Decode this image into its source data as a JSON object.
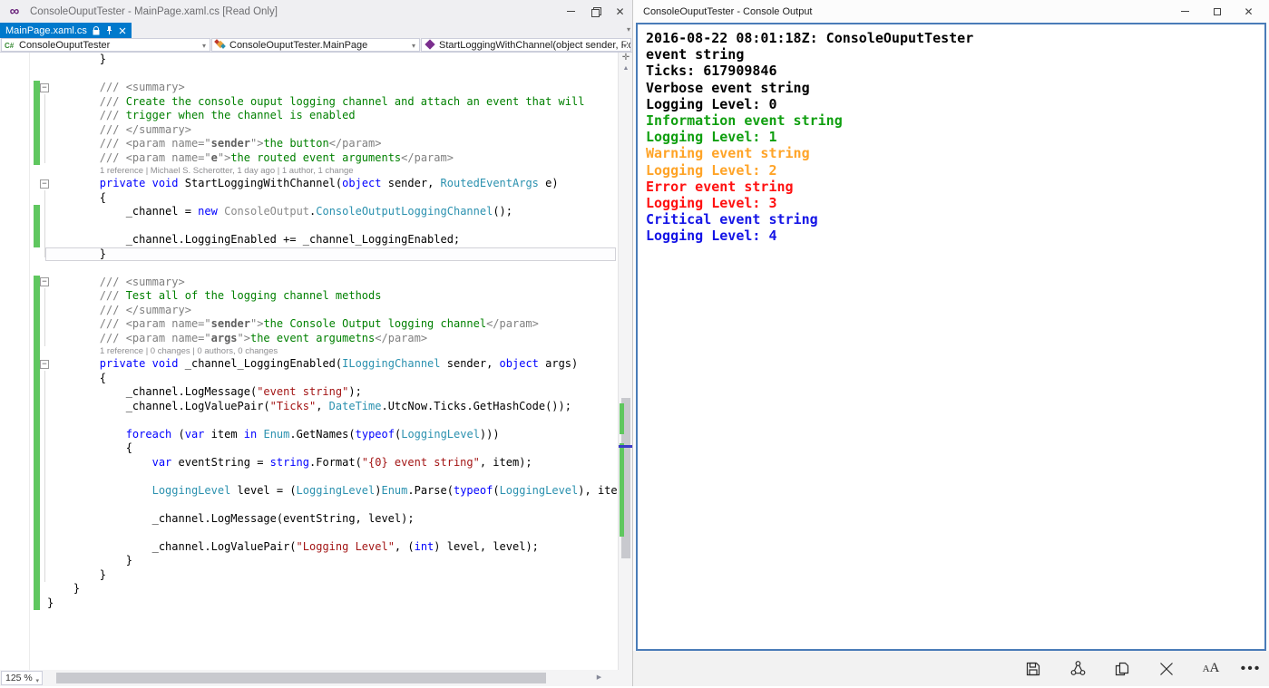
{
  "vs_window": {
    "title": "ConsoleOuputTester - MainPage.xaml.cs [Read Only]",
    "tab_label": "MainPage.xaml.cs",
    "tab_icons": [
      "lock-icon",
      "pin-icon",
      "close-icon"
    ],
    "nav_project": "ConsoleOuputTester",
    "nav_class": "ConsoleOuputTester.MainPage",
    "nav_method": "StartLoggingWithChannel(object sender, RoutedEver",
    "zoom_level": "125 %",
    "syntax_palette": {
      "plain": "#000000",
      "keyword": "#0000FF",
      "type": "#2B91AF",
      "string": "#A31515",
      "comment": "#008000",
      "doc_tag": "#808080",
      "faded_namespace": "#8A8A8A",
      "change_bar": "#5FC75F",
      "active_tab": "#0079CC"
    },
    "code_lines": [
      {
        "type": "code",
        "seg": [
          [
            "p",
            "        }"
          ]
        ]
      },
      {
        "type": "blank"
      },
      {
        "type": "code",
        "bar": true,
        "fold": true,
        "seg": [
          [
            "g",
            "        /// <summary>"
          ]
        ]
      },
      {
        "type": "code",
        "bar": true,
        "seg": [
          [
            "g",
            "        /// "
          ],
          [
            "c",
            "Create the console ouput logging channel and attach an event that will"
          ]
        ]
      },
      {
        "type": "code",
        "bar": true,
        "seg": [
          [
            "g",
            "        /// "
          ],
          [
            "c",
            "trigger when the channel is enabled"
          ]
        ]
      },
      {
        "type": "code",
        "bar": true,
        "seg": [
          [
            "g",
            "        /// </summary>"
          ]
        ]
      },
      {
        "type": "code",
        "bar": true,
        "seg": [
          [
            "g",
            "        /// <param name=\""
          ],
          [
            "a",
            "sender"
          ],
          [
            "g",
            "\">"
          ],
          [
            "c",
            "the button"
          ],
          [
            "g",
            "</param>"
          ]
        ]
      },
      {
        "type": "code",
        "bar": true,
        "seg": [
          [
            "g",
            "        /// <param name=\""
          ],
          [
            "a",
            "e"
          ],
          [
            "g",
            "\">"
          ],
          [
            "c",
            "the routed event arguments"
          ],
          [
            "g",
            "</param>"
          ]
        ]
      },
      {
        "type": "lens",
        "text": "1 reference | Michael S. Scherotter, 1 day ago | 1 author, 1 change"
      },
      {
        "type": "code",
        "fold": true,
        "seg": [
          [
            "k",
            "        private"
          ],
          [
            "p",
            " "
          ],
          [
            "k",
            "void"
          ],
          [
            "p",
            " StartLoggingWithChannel("
          ],
          [
            "k",
            "object"
          ],
          [
            "p",
            " sender, "
          ],
          [
            "t",
            "RoutedEventArgs"
          ],
          [
            "p",
            " e)"
          ]
        ]
      },
      {
        "type": "code",
        "seg": [
          [
            "p",
            "        {"
          ]
        ]
      },
      {
        "type": "code",
        "bar": true,
        "seg": [
          [
            "p",
            "            _channel = "
          ],
          [
            "k",
            "new"
          ],
          [
            "p",
            " "
          ],
          [
            "f",
            "ConsoleOutput"
          ],
          [
            "p",
            "."
          ],
          [
            "t",
            "ConsoleOutputLoggingChannel"
          ],
          [
            "p",
            "();"
          ]
        ]
      },
      {
        "type": "blank",
        "bar": true
      },
      {
        "type": "code",
        "bar": true,
        "seg": [
          [
            "p",
            "            _channel.LoggingEnabled += _channel_LoggingEnabled;"
          ]
        ]
      },
      {
        "type": "code",
        "hl": true,
        "seg": [
          [
            "p",
            "        }"
          ]
        ]
      },
      {
        "type": "blank"
      },
      {
        "type": "code",
        "bar": true,
        "fold": true,
        "seg": [
          [
            "g",
            "        /// <summary>"
          ]
        ]
      },
      {
        "type": "code",
        "bar": true,
        "seg": [
          [
            "g",
            "        /// "
          ],
          [
            "c",
            "Test all of the logging channel methods"
          ]
        ]
      },
      {
        "type": "code",
        "bar": true,
        "seg": [
          [
            "g",
            "        /// </summary>"
          ]
        ]
      },
      {
        "type": "code",
        "bar": true,
        "seg": [
          [
            "g",
            "        /// <param name=\""
          ],
          [
            "a",
            "sender"
          ],
          [
            "g",
            "\">"
          ],
          [
            "c",
            "the Console Output logging channel"
          ],
          [
            "g",
            "</param>"
          ]
        ]
      },
      {
        "type": "code",
        "bar": true,
        "seg": [
          [
            "g",
            "        /// <param name=\""
          ],
          [
            "a",
            "args"
          ],
          [
            "g",
            "\">"
          ],
          [
            "c",
            "the event argumetns"
          ],
          [
            "g",
            "</param>"
          ]
        ]
      },
      {
        "type": "lens",
        "bar": true,
        "text": "1 reference | 0 changes | 0 authors, 0 changes"
      },
      {
        "type": "code",
        "bar": true,
        "fold": true,
        "seg": [
          [
            "k",
            "        private"
          ],
          [
            "p",
            " "
          ],
          [
            "k",
            "void"
          ],
          [
            "p",
            " _channel_LoggingEnabled("
          ],
          [
            "t",
            "ILoggingChannel"
          ],
          [
            "p",
            " sender, "
          ],
          [
            "k",
            "object"
          ],
          [
            "p",
            " args)"
          ]
        ]
      },
      {
        "type": "code",
        "bar": true,
        "seg": [
          [
            "p",
            "        {"
          ]
        ]
      },
      {
        "type": "code",
        "bar": true,
        "seg": [
          [
            "p",
            "            _channel.LogMessage("
          ],
          [
            "s",
            "\"event string\""
          ],
          [
            "p",
            ");"
          ]
        ]
      },
      {
        "type": "code",
        "bar": true,
        "seg": [
          [
            "p",
            "            _channel.LogValuePair("
          ],
          [
            "s",
            "\"Ticks\""
          ],
          [
            "p",
            ", "
          ],
          [
            "t",
            "DateTime"
          ],
          [
            "p",
            ".UtcNow.Ticks.GetHashCode());"
          ]
        ]
      },
      {
        "type": "blank",
        "bar": true
      },
      {
        "type": "code",
        "bar": true,
        "seg": [
          [
            "k",
            "            foreach"
          ],
          [
            "p",
            " ("
          ],
          [
            "k",
            "var"
          ],
          [
            "p",
            " item "
          ],
          [
            "k",
            "in"
          ],
          [
            "p",
            " "
          ],
          [
            "t",
            "Enum"
          ],
          [
            "p",
            ".GetNames("
          ],
          [
            "k",
            "typeof"
          ],
          [
            "p",
            "("
          ],
          [
            "t",
            "LoggingLevel"
          ],
          [
            "p",
            ")))"
          ]
        ]
      },
      {
        "type": "code",
        "bar": true,
        "seg": [
          [
            "p",
            "            {"
          ]
        ]
      },
      {
        "type": "code",
        "bar": true,
        "seg": [
          [
            "k",
            "                var"
          ],
          [
            "p",
            " eventString = "
          ],
          [
            "k",
            "string"
          ],
          [
            "p",
            ".Format("
          ],
          [
            "s",
            "\"{0} event string\""
          ],
          [
            "p",
            ", item);"
          ]
        ]
      },
      {
        "type": "blank",
        "bar": true
      },
      {
        "type": "code",
        "bar": true,
        "seg": [
          [
            "t",
            "                LoggingLevel"
          ],
          [
            "p",
            " level = ("
          ],
          [
            "t",
            "LoggingLevel"
          ],
          [
            "p",
            ")"
          ],
          [
            "t",
            "Enum"
          ],
          [
            "p",
            ".Parse("
          ],
          [
            "k",
            "typeof"
          ],
          [
            "p",
            "("
          ],
          [
            "t",
            "LoggingLevel"
          ],
          [
            "p",
            "), item);"
          ]
        ]
      },
      {
        "type": "blank",
        "bar": true
      },
      {
        "type": "code",
        "bar": true,
        "seg": [
          [
            "p",
            "                _channel.LogMessage(eventString, level);"
          ]
        ]
      },
      {
        "type": "blank",
        "bar": true
      },
      {
        "type": "code",
        "bar": true,
        "seg": [
          [
            "p",
            "                _channel.LogValuePair("
          ],
          [
            "s",
            "\"Logging Level\""
          ],
          [
            "p",
            ", ("
          ],
          [
            "k",
            "int"
          ],
          [
            "p",
            ") level, level);"
          ]
        ]
      },
      {
        "type": "code",
        "bar": true,
        "seg": [
          [
            "p",
            "            }"
          ]
        ]
      },
      {
        "type": "code",
        "bar": true,
        "seg": [
          [
            "p",
            "        }"
          ]
        ]
      },
      {
        "type": "code",
        "bar": true,
        "seg": [
          [
            "p",
            "    }"
          ]
        ]
      },
      {
        "type": "code",
        "bar": true,
        "seg": [
          [
            "p",
            "}"
          ]
        ]
      }
    ]
  },
  "console_window": {
    "title": "ConsoleOuputTester - Console Output",
    "palette": {
      "black": "#000000",
      "green": "#0F9F0F",
      "orange": "#FFA428",
      "red": "#FF1111",
      "blue": "#1414E6",
      "border": "#4A7CB8"
    },
    "lines": [
      {
        "text": "2016-08-22 08:01:18Z: ConsoleOuputTester",
        "color": "black"
      },
      {
        "text": "event string",
        "color": "black"
      },
      {
        "text": "Ticks: 617909846",
        "color": "black"
      },
      {
        "text": "Verbose event string",
        "color": "black"
      },
      {
        "text": "Logging Level: 0",
        "color": "black"
      },
      {
        "text": "Information event string",
        "color": "green"
      },
      {
        "text": "Logging Level: 1",
        "color": "green"
      },
      {
        "text": "Warning event string",
        "color": "orange"
      },
      {
        "text": "Logging Level: 2",
        "color": "orange"
      },
      {
        "text": "Error event string",
        "color": "red"
      },
      {
        "text": "Logging Level: 3",
        "color": "red"
      },
      {
        "text": "Critical event string",
        "color": "blue"
      },
      {
        "text": "Logging Level: 4",
        "color": "blue"
      }
    ],
    "toolbar_icons": [
      "save-icon",
      "share-icon",
      "copy-icon",
      "clear-icon",
      "font-size-icon",
      "more-icon"
    ]
  }
}
